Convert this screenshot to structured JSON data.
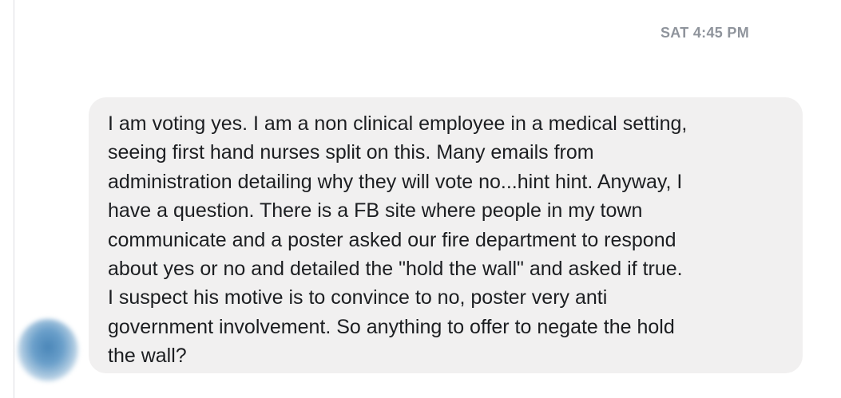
{
  "conversation": {
    "timestamp": "SAT 4:45 PM",
    "message": {
      "lines": [
        "I am voting yes. I am a non clinical employee in a medical setting,",
        "seeing first hand nurses split on this. Many emails from",
        "administration detailing why they will vote no...hint hint. Anyway, I",
        "have a question. There is a FB site where people in my town",
        "communicate and a poster asked our fire department to respond",
        "about yes or no and detailed the \"hold the wall\" and asked if true.",
        "I suspect his motive is to convince to no, poster very anti",
        "government involvement. So anything to offer to negate the hold",
        "the wall?"
      ]
    }
  }
}
